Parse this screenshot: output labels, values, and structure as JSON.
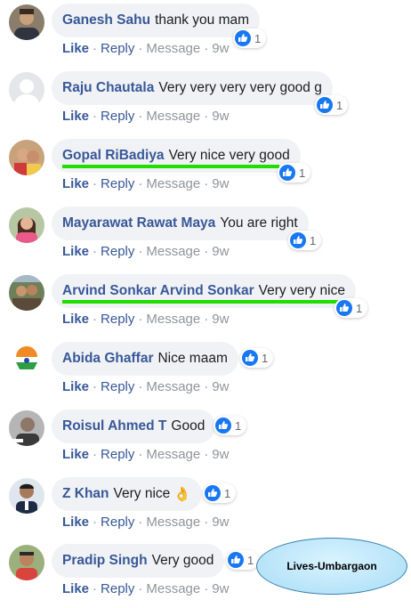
{
  "actions": {
    "like": "Like",
    "reply": "Reply",
    "message": "Message",
    "separator": "·"
  },
  "comments": [
    {
      "name": "Ganesh Sahu",
      "text": "thank you mam",
      "emoji": "",
      "likes": "1",
      "time": "9w"
    },
    {
      "name": "Raju Chautala",
      "text": "Very very very very good g",
      "emoji": "",
      "likes": "1",
      "time": "9w"
    },
    {
      "name": "Gopal RiBadiya",
      "text": "Very nice very good",
      "emoji": "",
      "likes": "1",
      "time": "9w"
    },
    {
      "name": "Mayarawat Rawat Maya",
      "text": "You are right",
      "emoji": "",
      "likes": "1",
      "time": "9w"
    },
    {
      "name": "Arvind Sonkar Arvind Sonkar",
      "text": "Very very nice",
      "emoji": "",
      "likes": "1",
      "time": "9w"
    },
    {
      "name": "Abida Ghaffar",
      "text": "Nice maam",
      "emoji": "",
      "likes": "1",
      "time": "9w"
    },
    {
      "name": "Roisul Ahmed T",
      "text": "Good",
      "emoji": "",
      "likes": "1",
      "time": "9w"
    },
    {
      "name": "Z Khan",
      "text": "Very nice",
      "emoji": "👌",
      "likes": "1",
      "time": "9w"
    },
    {
      "name": "Pradip Singh",
      "text": "Very good",
      "emoji": "",
      "likes": "1",
      "time": "9w"
    }
  ],
  "watermark": {
    "text": "Lives-Umbargaon"
  },
  "icons": {
    "reaction": "like-thumbs-up-icon",
    "avatar_placeholder": "default-user-silhouette-icon"
  },
  "colors": {
    "name": "#385898",
    "like_blue": "#1877f2",
    "bubble": "#f0f2f5",
    "meta": "#90949c",
    "highlight": "#22dd00"
  }
}
